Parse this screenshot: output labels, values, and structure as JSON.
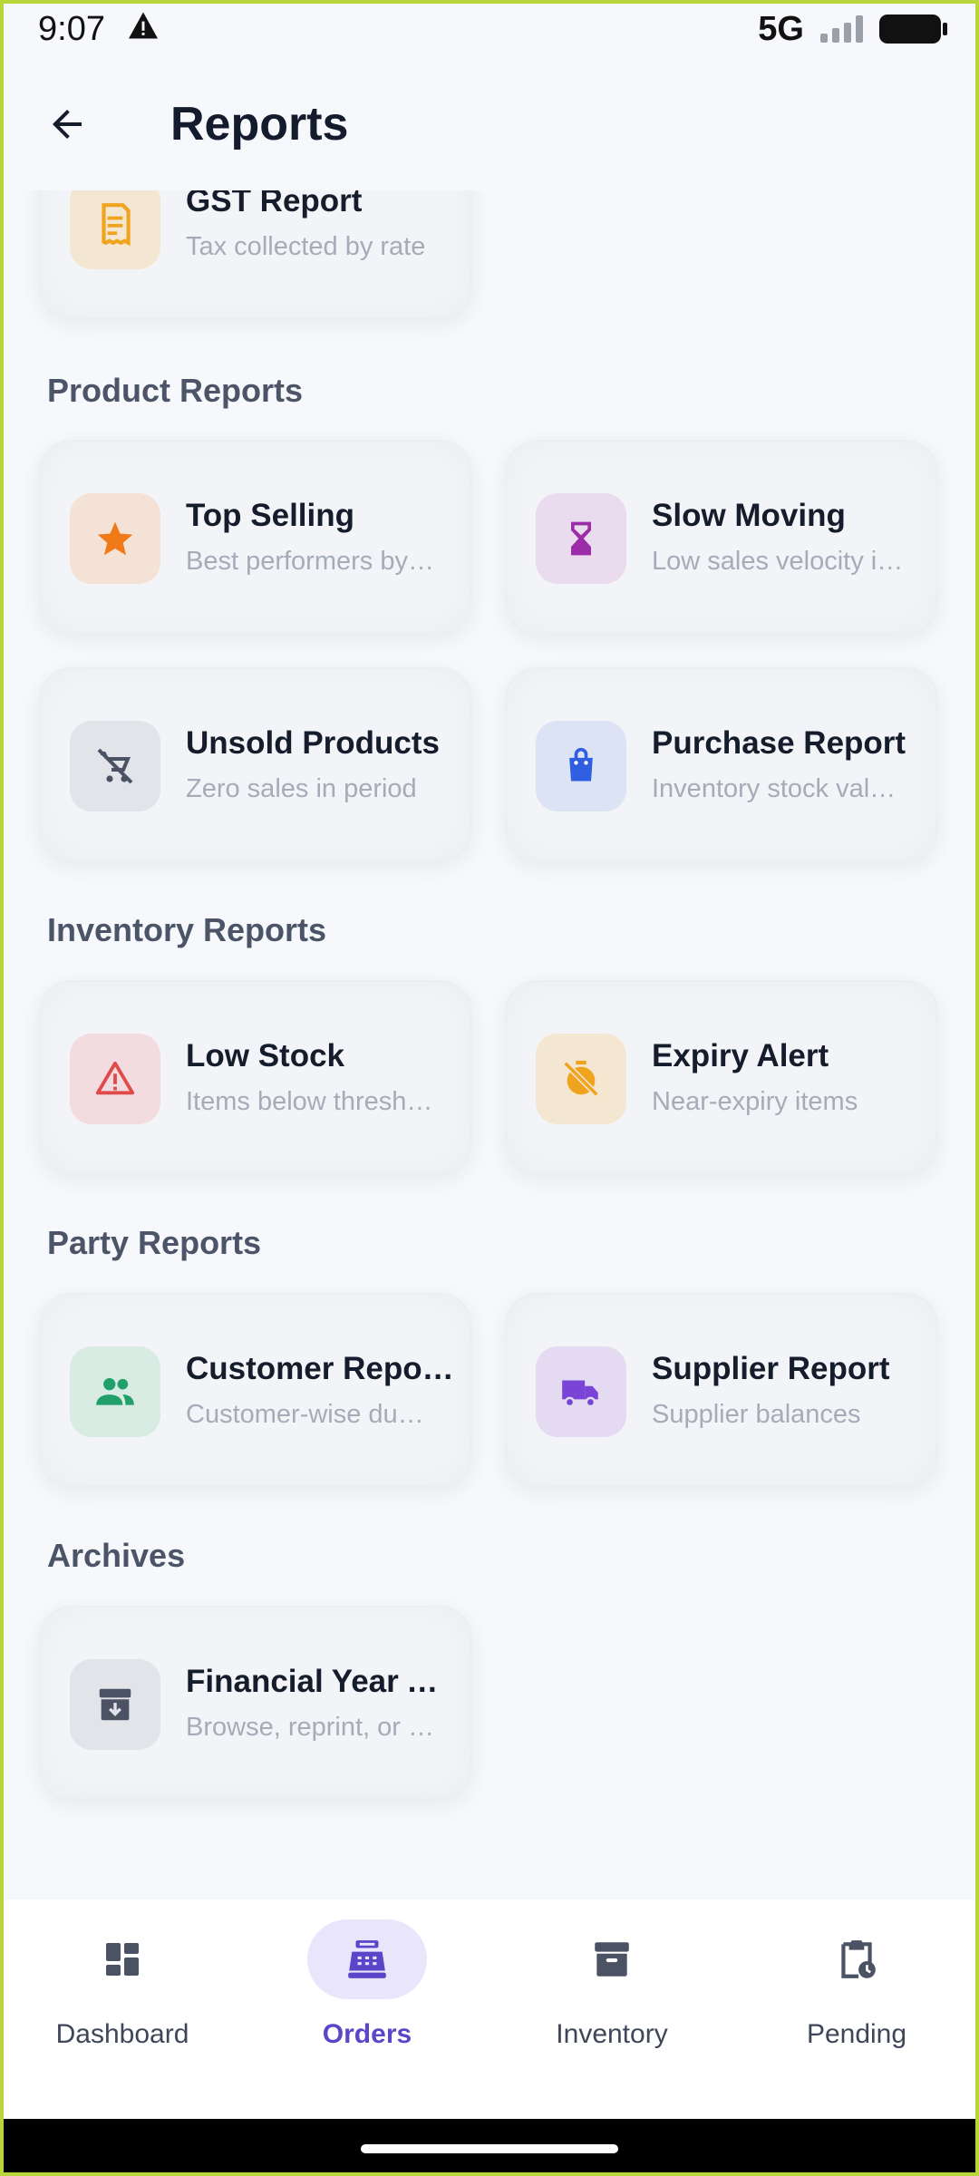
{
  "status_bar": {
    "time": "9:07",
    "network": "5G"
  },
  "header": {
    "title": "Reports"
  },
  "sections": {
    "gst": {
      "cards": [
        {
          "title": "GST Report",
          "desc": "Tax collected by rate",
          "icon": "receipt-icon",
          "color": "#f0a31e",
          "bg": "#f4e7d2"
        }
      ]
    },
    "product": {
      "label": "Product Reports",
      "cards": [
        {
          "title": "Top Selling",
          "desc": "Best performers by…",
          "icon": "star-icon",
          "color": "#f07a1a",
          "bg": "#f4e2d6"
        },
        {
          "title": "Slow Moving",
          "desc": "Low sales velocity i…",
          "icon": "hourglass-icon",
          "color": "#9b2ea8",
          "bg": "#eadbee"
        },
        {
          "title": "Unsold Products",
          "desc": "Zero sales in period",
          "icon": "remove-shopping-cart-icon",
          "color": "#4a5263",
          "bg": "#e2e4e9"
        },
        {
          "title": "Purchase Report",
          "desc": "Inventory stock val…",
          "icon": "shopping-bag-icon",
          "color": "#2f5fe0",
          "bg": "#dce3f4"
        }
      ]
    },
    "inventory": {
      "label": "Inventory Reports",
      "cards": [
        {
          "title": "Low Stock",
          "desc": "Items below thresh…",
          "icon": "warning-icon",
          "color": "#e04a4a",
          "bg": "#f3dcdf"
        },
        {
          "title": "Expiry Alert",
          "desc": "Near-expiry items",
          "icon": "timer-off-icon",
          "color": "#f0a31e",
          "bg": "#f4e7d2"
        }
      ]
    },
    "party": {
      "label": "Party Reports",
      "cards": [
        {
          "title": "Customer Repo…",
          "desc": "Customer-wise du…",
          "icon": "people-icon",
          "color": "#22a06b",
          "bg": "#d8ece4"
        },
        {
          "title": "Supplier Report",
          "desc": "Supplier balances",
          "icon": "truck-icon",
          "color": "#7a45d6",
          "bg": "#e4dbf2"
        }
      ]
    },
    "archives": {
      "label": "Archives",
      "cards": [
        {
          "title": "Financial Year A…",
          "desc": "Browse, reprint, or …",
          "icon": "archive-icon",
          "color": "#4a5263",
          "bg": "#e2e4e9"
        }
      ]
    }
  },
  "bottom_nav": {
    "items": [
      {
        "label": "Dashboard",
        "icon": "dashboard-icon",
        "active": false
      },
      {
        "label": "Orders",
        "icon": "cash-register-icon",
        "active": true
      },
      {
        "label": "Inventory",
        "icon": "archive-box-icon",
        "active": false
      },
      {
        "label": "Pending",
        "icon": "clipboard-clock-icon",
        "active": false
      }
    ]
  }
}
